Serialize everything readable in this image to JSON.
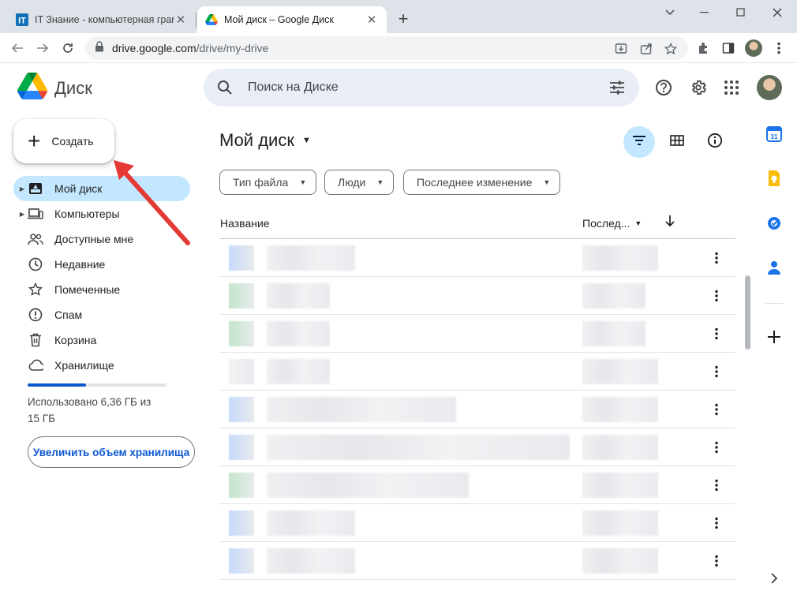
{
  "browser": {
    "tabs": [
      {
        "title": "IT Знание - компьютерная грам",
        "active": false
      },
      {
        "title": "Мой диск – Google Диск",
        "active": true
      }
    ],
    "url_host": "drive.google.com",
    "url_path": "/drive/my-drive"
  },
  "header": {
    "app_name": "Диск",
    "search_placeholder": "Поиск на Диске"
  },
  "sidebar": {
    "create_label": "Создать",
    "items": [
      {
        "label": "Мой диск",
        "icon": "my-drive-icon",
        "active": true
      },
      {
        "label": "Компьютеры",
        "icon": "computer-icon",
        "active": false
      },
      {
        "label": "Доступные мне",
        "icon": "people-icon",
        "active": false
      },
      {
        "label": "Недавние",
        "icon": "clock-icon",
        "active": false
      },
      {
        "label": "Помеченные",
        "icon": "star-icon",
        "active": false
      },
      {
        "label": "Спам",
        "icon": "spam-icon",
        "active": false
      },
      {
        "label": "Корзина",
        "icon": "trash-icon",
        "active": false
      },
      {
        "label": "Хранилище",
        "icon": "cloud-icon",
        "active": false
      }
    ],
    "storage_used_fraction": 0.42,
    "storage_text_line1": "Использовано 6,36 ГБ из",
    "storage_text_line2": "15 ГБ",
    "upgrade_label": "Увеличить объем хранилища"
  },
  "main": {
    "title": "Мой диск",
    "filters": [
      "Тип файла",
      "Люди",
      "Последнее изменение"
    ],
    "columns": {
      "name": "Название",
      "modified": "Послед..."
    },
    "row_count": 9
  },
  "colors": {
    "accent": "#0b57d0",
    "active_nav": "#c2e7ff",
    "search_bg": "#e9eef6",
    "annotation_arrow": "#e53935"
  }
}
